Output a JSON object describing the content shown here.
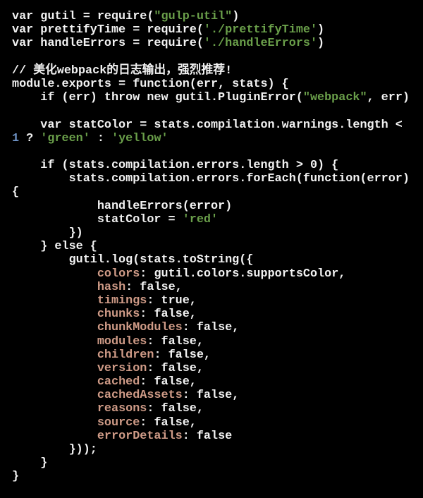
{
  "colors": {
    "background": "#000000",
    "text": "#f2f2f2",
    "string": "#6a9f4a",
    "property": "#cf9b87",
    "number": "#6f93c6"
  },
  "code_lines": [
    [
      [
        "var gutil = require(",
        "plain"
      ],
      [
        "\"gulp-util\"",
        "str"
      ],
      [
        ")",
        "plain"
      ]
    ],
    [
      [
        "var prettifyTime = require(",
        "plain"
      ],
      [
        "'./prettifyTime'",
        "str"
      ],
      [
        ")",
        "plain"
      ]
    ],
    [
      [
        "var handleErrors = require(",
        "plain"
      ],
      [
        "'./handleErrors'",
        "str"
      ],
      [
        ")",
        "plain"
      ]
    ],
    [],
    [
      [
        "// 美化webpack的日志输出，强烈推荐!",
        "cmt"
      ]
    ],
    [
      [
        "module.exports = function(err, stats) {",
        "plain"
      ]
    ],
    [
      [
        "    if (err) throw new gutil.PluginError(",
        "plain"
      ],
      [
        "\"webpack\"",
        "str"
      ],
      [
        ", err)",
        "plain"
      ]
    ],
    [],
    [
      [
        "    var statColor = stats.compilation.warnings.length <",
        "plain"
      ]
    ],
    [
      [
        "1",
        "num"
      ],
      [
        " ? ",
        "plain"
      ],
      [
        "'green'",
        "str"
      ],
      [
        " : ",
        "plain"
      ],
      [
        "'yellow'",
        "str"
      ]
    ],
    [],
    [
      [
        "    if (stats.compilation.errors.length > 0) {",
        "plain"
      ]
    ],
    [
      [
        "        stats.compilation.errors.forEach(function(error)",
        "plain"
      ]
    ],
    [
      [
        "{",
        "plain"
      ]
    ],
    [
      [
        "            handleErrors(error)",
        "plain"
      ]
    ],
    [
      [
        "            statColor = ",
        "plain"
      ],
      [
        "'red'",
        "str"
      ]
    ],
    [
      [
        "        })",
        "plain"
      ]
    ],
    [
      [
        "    } else {",
        "plain"
      ]
    ],
    [
      [
        "        gutil.log(stats.toString({",
        "plain"
      ]
    ],
    [
      [
        "            ",
        "plain"
      ],
      [
        "colors",
        "key"
      ],
      [
        ": gutil.colors.supportsColor,",
        "plain"
      ]
    ],
    [
      [
        "            ",
        "plain"
      ],
      [
        "hash",
        "key"
      ],
      [
        ": false,",
        "plain"
      ]
    ],
    [
      [
        "            ",
        "plain"
      ],
      [
        "timings",
        "key"
      ],
      [
        ": true,",
        "plain"
      ]
    ],
    [
      [
        "            ",
        "plain"
      ],
      [
        "chunks",
        "key"
      ],
      [
        ": false,",
        "plain"
      ]
    ],
    [
      [
        "            ",
        "plain"
      ],
      [
        "chunkModules",
        "key"
      ],
      [
        ": false,",
        "plain"
      ]
    ],
    [
      [
        "            ",
        "plain"
      ],
      [
        "modules",
        "key"
      ],
      [
        ": false,",
        "plain"
      ]
    ],
    [
      [
        "            ",
        "plain"
      ],
      [
        "children",
        "key"
      ],
      [
        ": false,",
        "plain"
      ]
    ],
    [
      [
        "            ",
        "plain"
      ],
      [
        "version",
        "key"
      ],
      [
        ": false,",
        "plain"
      ]
    ],
    [
      [
        "            ",
        "plain"
      ],
      [
        "cached",
        "key"
      ],
      [
        ": false,",
        "plain"
      ]
    ],
    [
      [
        "            ",
        "plain"
      ],
      [
        "cachedAssets",
        "key"
      ],
      [
        ": false,",
        "plain"
      ]
    ],
    [
      [
        "            ",
        "plain"
      ],
      [
        "reasons",
        "key"
      ],
      [
        ": false,",
        "plain"
      ]
    ],
    [
      [
        "            ",
        "plain"
      ],
      [
        "source",
        "key"
      ],
      [
        ": false,",
        "plain"
      ]
    ],
    [
      [
        "            ",
        "plain"
      ],
      [
        "errorDetails",
        "key"
      ],
      [
        ": false",
        "plain"
      ]
    ],
    [
      [
        "        }));",
        "plain"
      ]
    ],
    [
      [
        "    }",
        "plain"
      ]
    ],
    [
      [
        "}",
        "plain"
      ]
    ]
  ]
}
